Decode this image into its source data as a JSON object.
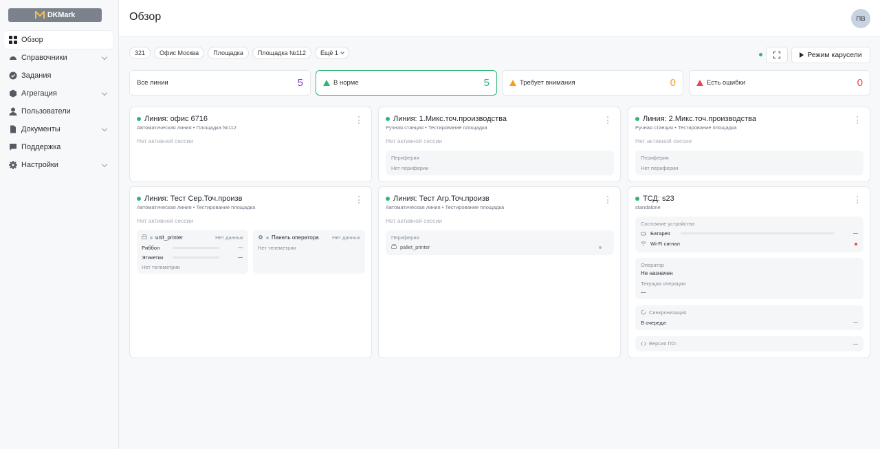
{
  "brand": {
    "logo_text": "DKMark"
  },
  "sidebar": {
    "items": [
      {
        "label": "Обзор",
        "icon": "grid-icon",
        "active": true,
        "has_children": false
      },
      {
        "label": "Справочники",
        "icon": "dashboard-icon",
        "active": false,
        "has_children": true
      },
      {
        "label": "Задания",
        "icon": "check-circle-icon",
        "active": false,
        "has_children": false
      },
      {
        "label": "Агрегация",
        "icon": "box-icon",
        "active": false,
        "has_children": true
      },
      {
        "label": "Пользователи",
        "icon": "user-icon",
        "active": false,
        "has_children": false
      },
      {
        "label": "Документы",
        "icon": "document-icon",
        "active": false,
        "has_children": true
      },
      {
        "label": "Поддержка",
        "icon": "chat-icon",
        "active": false,
        "has_children": false
      },
      {
        "label": "Настройки",
        "icon": "gear-icon",
        "active": false,
        "has_children": true
      }
    ]
  },
  "header": {
    "title": "Обзор",
    "avatar_initials": "ПВ"
  },
  "filters": {
    "chips": [
      "321",
      "Офис Москва",
      "Площадка",
      "Площадка №112"
    ],
    "more_label": "Ещё 1"
  },
  "toolbar": {
    "carousel_label": "Режим карусели"
  },
  "stats": [
    {
      "label": "Все линии",
      "value": "5",
      "color": "#7b3fc4"
    },
    {
      "label": "В норме",
      "value": "5",
      "color": "#2fb577"
    },
    {
      "label": "Требует внимания",
      "value": "0",
      "color": "#f0a020"
    },
    {
      "label": "Есть ошибки",
      "value": "0",
      "color": "#e5484d"
    }
  ],
  "common": {
    "no_session": "Нет активной сессии",
    "peripherals": "Периферия",
    "no_peripherals": "Нет периферии",
    "no_data": "Нет данных",
    "no_telemetry": "Нет телеметрии",
    "dash": "—"
  },
  "cards": [
    {
      "title": "Линия: офис 6716",
      "subtitle": "Автоматическая линия • Площадка №112"
    },
    {
      "title": "Линия: 1.Микс.точ.производства",
      "subtitle": "Ручная станция • Тестирование площадка"
    },
    {
      "title": "Линия: 2.Микс.точ.производства",
      "subtitle": "Ручная станция • Тестирование площадка"
    },
    {
      "title": "Линия: Тест Сер.Точ.произв",
      "subtitle": "Автоматическая линия • Тестирование площадка",
      "printer": {
        "name": "unit_printer",
        "ribbon": "Риббон",
        "labels": "Этикетки"
      },
      "operator_panel": "Панель оператора"
    },
    {
      "title": "Линия: Тест Агр.Точ.произв",
      "subtitle": "Автоматическая линия • Тестирование площадка",
      "device": "pallet_printer"
    },
    {
      "title": "ТСД: s23",
      "subtitle": "standalone",
      "device_state": "Состояние устройства",
      "battery": "Батарея",
      "wifi": "Wi-Fi сигнал",
      "operator_label": "Оператор",
      "operator_value": "Не назначен",
      "current_op_label": "Текущая операция",
      "sync_label": "Синхронизация",
      "queue_label": "В очереди:",
      "version_label": "Версия ПО:"
    }
  ],
  "colors": {
    "green": "#2fb577",
    "red": "#e5484d"
  }
}
